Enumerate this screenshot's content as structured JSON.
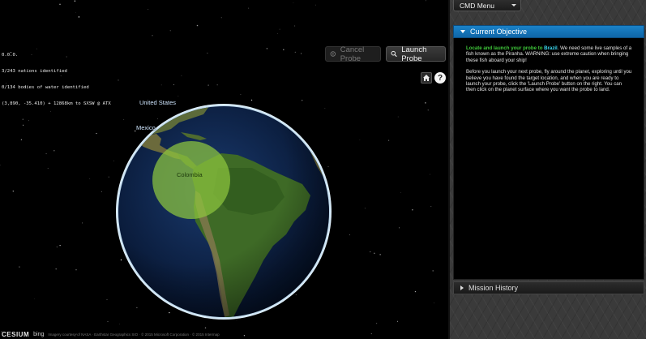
{
  "hud": {
    "lines": [
      "0.0.0.",
      "3/243 nations identified",
      "0/134 bodies of water identified",
      "(3.890, -35.410) + 12868km to SXSW @ ATX"
    ]
  },
  "toolbar": {
    "cancel_label": "Cancel Probe",
    "launch_label": "Launch Probe",
    "cancel_icon": "cancel-icon",
    "launch_icon": "search-icon"
  },
  "nav": {
    "home_icon": "home-icon",
    "help_label": "?"
  },
  "map_labels": {
    "us": "United States",
    "mexico": "Mexico",
    "colombia": "Colombia"
  },
  "target": {
    "color": "#8ec63f",
    "center_lat": 3.89,
    "center_lon": -65.0
  },
  "attribution": {
    "cesium": "CESIUM",
    "bing": "bing",
    "credits": "Imagery courtesy of NASA · Earthstar Geographics SIO · © 2015 Microsoft Corporation · © 2015 Intermap"
  },
  "panel": {
    "cmd_menu": "CMD Menu",
    "objective": {
      "title": "Current Objective",
      "intro_a": "Locate and launch your probe to ",
      "intro_country": "Brazil",
      "intro_b": ". We need some live samples of a fish known as the Piranha. WARNING: use extreme caution when bringing these fish aboard your ship!",
      "instructions": "Before you launch your next probe, fly around the planet, exploring until you believe you have found the target location, and when you are ready to launch your probe, click the 'Launch Probe' button on the right. You can then click on the planet surface where you want the probe to land."
    },
    "history": {
      "title": "Mission History"
    }
  },
  "colors": {
    "accent": "#1a82c8",
    "green": "#3fc83a",
    "cyan": "#3ad8f0",
    "target_fill": "#8ec63f"
  }
}
